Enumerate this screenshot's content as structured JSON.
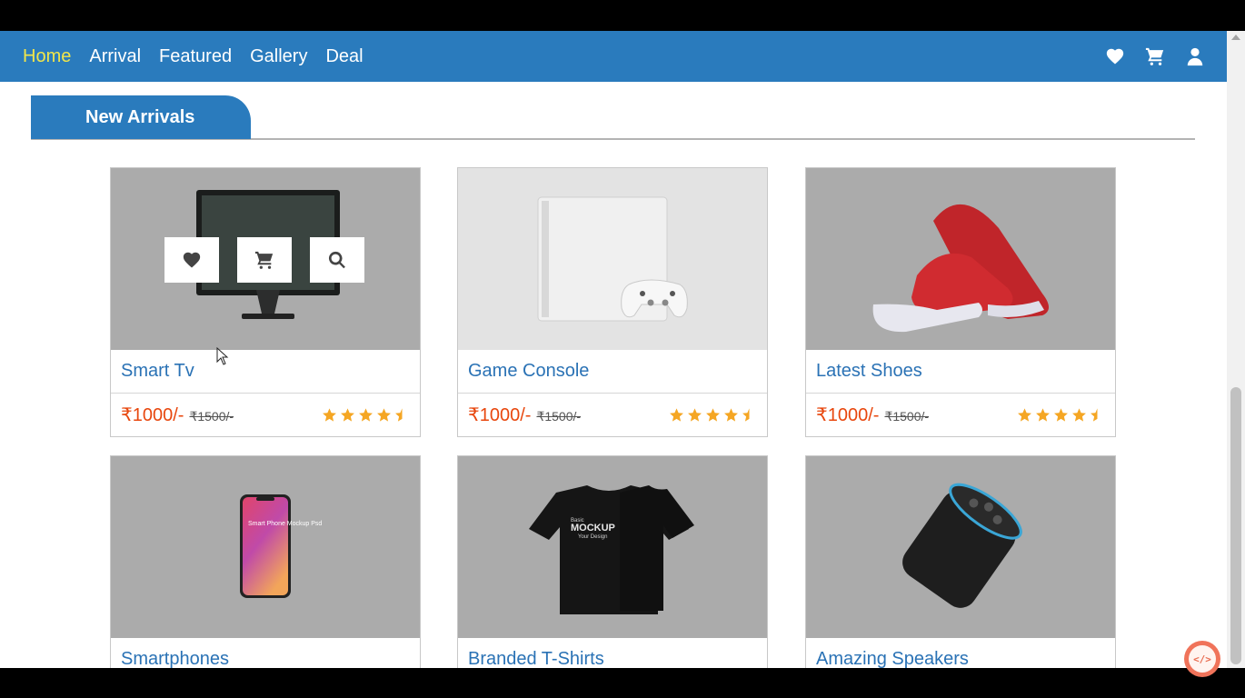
{
  "nav": {
    "links": [
      "Home",
      "Arrival",
      "Featured",
      "Gallery",
      "Deal"
    ],
    "active_color": "#f1e64a",
    "bar_color": "#2a7bbd",
    "icons": [
      "heart-icon",
      "cart-icon",
      "user-icon"
    ]
  },
  "section": {
    "title": "New Arrivals"
  },
  "products": [
    {
      "name": "Smart Tv",
      "price": "₹1000/-",
      "old_price": "₹1500/-",
      "rating": 4.5
    },
    {
      "name": "Game Console",
      "price": "₹1000/-",
      "old_price": "₹1500/-",
      "rating": 4.5
    },
    {
      "name": "Latest Shoes",
      "price": "₹1000/-",
      "old_price": "₹1500/-",
      "rating": 4.5
    },
    {
      "name": "Smartphones"
    },
    {
      "name": "Branded T-Shirts"
    },
    {
      "name": "Amazing Speakers"
    }
  ],
  "phone_screen_text": "Smart Phone Mockup Psd",
  "tshirt_text": {
    "main": "MOCKUP",
    "top": "Basic",
    "bottom": "Your Design"
  },
  "hover_actions": [
    "heart-icon",
    "cart-icon",
    "search-icon"
  ],
  "badge": {
    "label": "</>",
    "color": "#f0735a"
  },
  "colors": {
    "price": "#e8470e",
    "title": "#2a72b5",
    "star": "#f5a623"
  }
}
